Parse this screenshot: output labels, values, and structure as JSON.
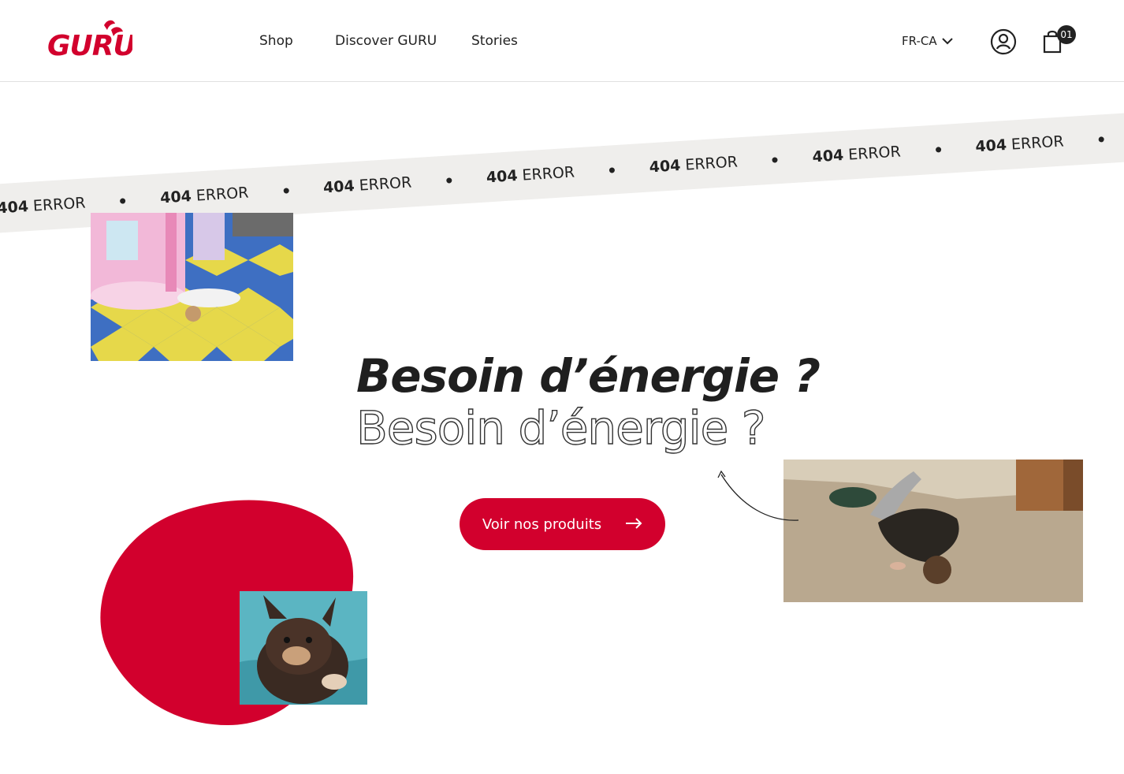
{
  "header": {
    "logo_text": "GURU",
    "nav": [
      {
        "label": "Shop"
      },
      {
        "label": "Discover GURU"
      },
      {
        "label": "Stories"
      }
    ],
    "language": "FR-CA",
    "cart_count": "01"
  },
  "ticker": {
    "number": "404",
    "word": "ERROR"
  },
  "hero": {
    "headline": "Besoin d’énergie ?",
    "headline_outline": "Besoin d’énergie ?",
    "cta_label": "Voir nos produits"
  },
  "colors": {
    "brand_red": "#d2002d",
    "ticker_bg": "#efeeec"
  },
  "icons": {
    "account": "account-icon",
    "cart": "shopping-bag-icon",
    "language": "chevron-down-icon",
    "cta": "arrow-right-icon"
  }
}
